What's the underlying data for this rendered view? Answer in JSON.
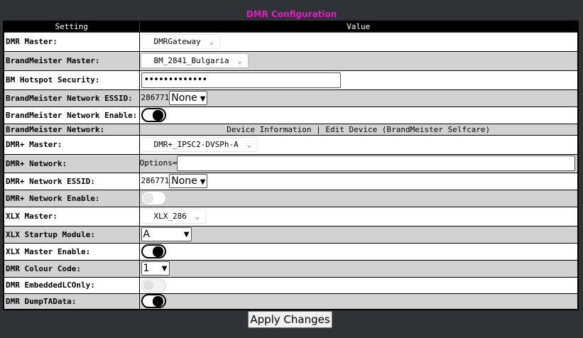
{
  "title": "DMR Configuration",
  "headers": {
    "setting": "Setting",
    "value": "Value"
  },
  "rows": {
    "dmr_master": {
      "label": "DMR Master:",
      "value": "DMRGateway"
    },
    "bm_master": {
      "label": "BrandMeister Master:",
      "value": "BM_2841_Bulgaria"
    },
    "bm_security": {
      "label": "BM Hotspot Security:",
      "value": "•••••••••••••"
    },
    "bm_essid": {
      "label": "BrandMeister Network ESSID:",
      "prefix": "286771",
      "value": "None"
    },
    "bm_enable": {
      "label": "BrandMeister Network Enable:",
      "state": "on"
    },
    "bm_network": {
      "label": "BrandMeister Network:",
      "device_info": "Device Information",
      "separator": "|",
      "edit_device": "Edit Device (BrandMeister Selfcare)"
    },
    "dmrplus_master": {
      "label": "DMR+ Master:",
      "value": "DMR+_IPSC2-DVSPh-A"
    },
    "dmrplus_network": {
      "label": "DMR+ Network:",
      "prefix": "Options=",
      "value": ""
    },
    "dmrplus_essid": {
      "label": "DMR+ Network ESSID:",
      "prefix": "286771",
      "value": "None"
    },
    "dmrplus_enable": {
      "label": "DMR+ Network Enable:",
      "state": "off"
    },
    "xlx_master": {
      "label": "XLX Master:",
      "value": "XLX_286"
    },
    "xlx_module": {
      "label": "XLX Startup Module:",
      "value": "A"
    },
    "xlx_enable": {
      "label": "XLX Master Enable:",
      "state": "on"
    },
    "colour_code": {
      "label": "DMR Colour Code:",
      "value": "1"
    },
    "embedded_lc": {
      "label": "DMR EmbeddedLCOnly:",
      "state": "disabled"
    },
    "dump_ta": {
      "label": "DMR DumpTAData:",
      "state": "on"
    }
  },
  "apply_label": "Apply Changes",
  "colors": {
    "title": "#e619c5",
    "background": "#2f3338",
    "row_alt": "#d2d2d2"
  },
  "icons": {
    "dropdown": "chevron-down-icon"
  }
}
